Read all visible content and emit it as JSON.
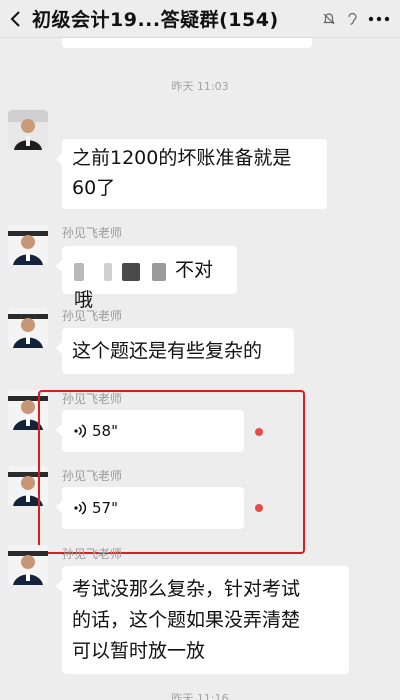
{
  "header": {
    "title": "初级会计19...答疑群(154)"
  },
  "messages": {
    "timestamp_top": "昨天 11:03",
    "timestamp_bottom": "昨天 11:16",
    "msg1": {
      "text_line1": "之前1200的坏账准备就是",
      "text_line2": "60了"
    },
    "msg2": {
      "sender": "孙见飞老师",
      "text": "不对哦"
    },
    "msg3": {
      "sender": "孙见飞老师",
      "text": "这个题还是有些复杂的"
    },
    "msg4": {
      "sender": "孙见飞老师",
      "duration": "58\""
    },
    "msg5": {
      "sender": "孙见飞老师",
      "duration": "57\""
    },
    "msg6": {
      "sender": "孙见飞老师",
      "line1": "考试没那么复杂，针对考试",
      "line2": "的话，这个题如果没弄清楚",
      "line3": "可以暂时放一放"
    }
  },
  "colors": {
    "background": "#ededed",
    "bubble": "#ffffff",
    "highlight": "#d91e1e",
    "unread_dot": "#e84a4a"
  },
  "icons": [
    "back-icon",
    "mute-icon",
    "ear-icon",
    "more-icon",
    "voice-icon"
  ]
}
